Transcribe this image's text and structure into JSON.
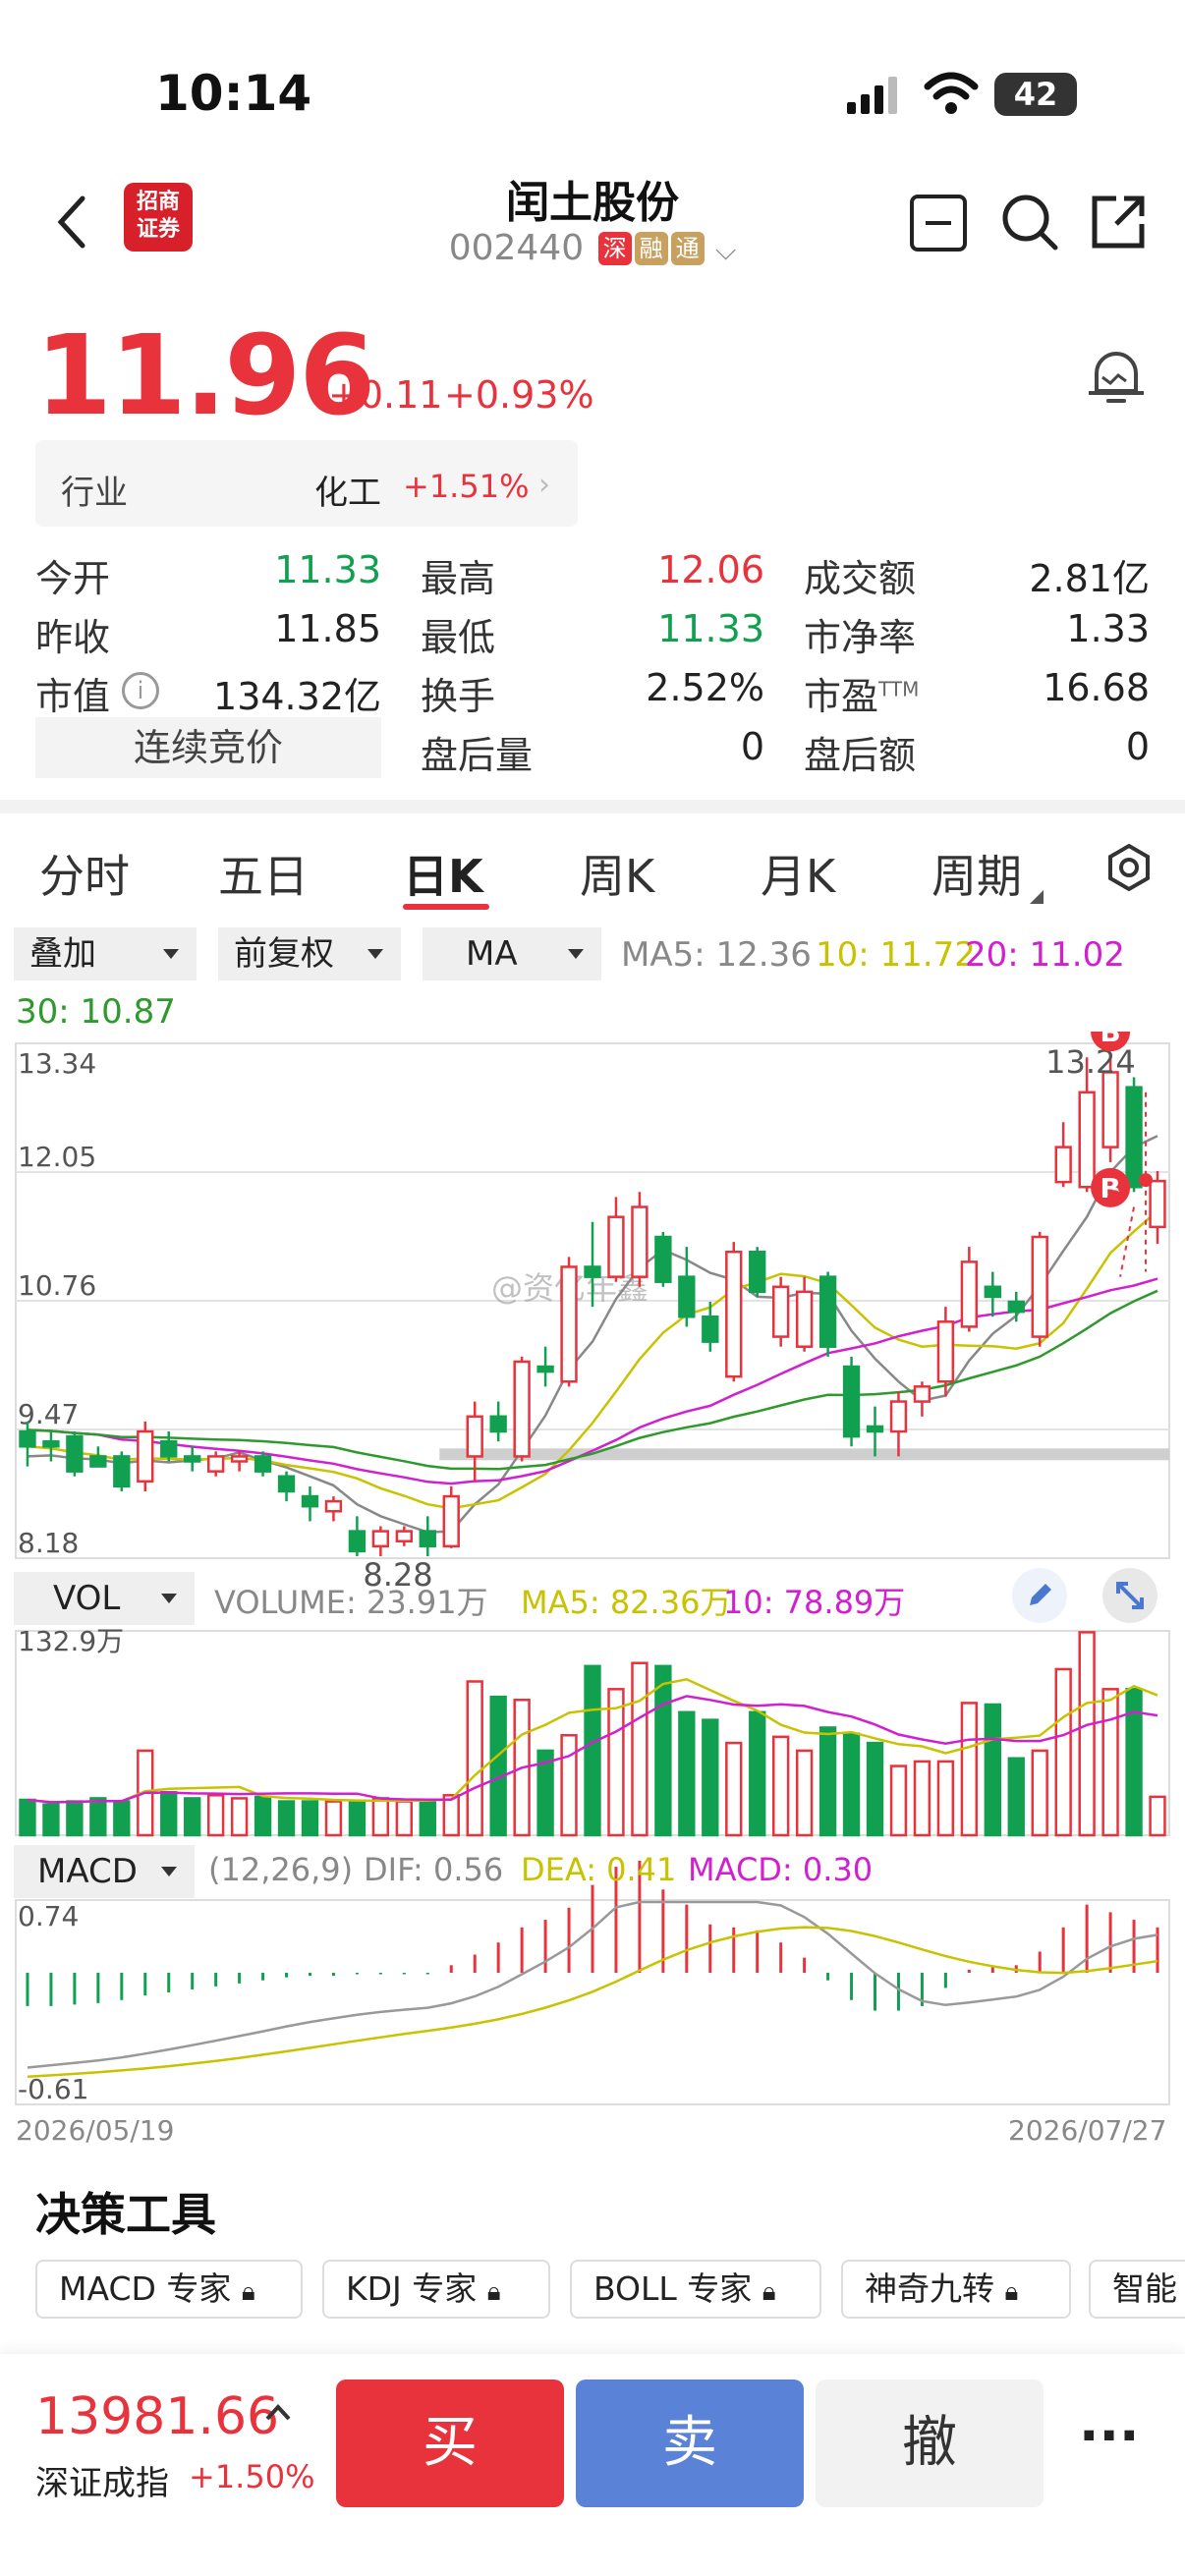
{
  "status": {
    "time": "10:14",
    "battery": "42"
  },
  "header": {
    "title": "闰土股份",
    "code": "002440",
    "tags": [
      "深",
      "融",
      "通"
    ],
    "logo_text": "招商证券"
  },
  "quote": {
    "price": "11.96",
    "change": "+0.11",
    "change_pct": "+0.93%"
  },
  "industry": {
    "label": "行业",
    "name": "化工",
    "pct": "+1.51%"
  },
  "stats": [
    {
      "label": "今开",
      "value": "11.33",
      "color": "green"
    },
    {
      "label": "最高",
      "value": "12.06",
      "color": "red"
    },
    {
      "label": "成交额",
      "value": "2.81亿",
      "color": "black"
    },
    {
      "label": "昨收",
      "value": "11.85",
      "color": "black"
    },
    {
      "label": "最低",
      "value": "11.33",
      "color": "green"
    },
    {
      "label": "市净率",
      "value": "1.33",
      "color": "black"
    },
    {
      "label": "市值",
      "value": "134.32亿",
      "color": "black"
    },
    {
      "label": "换手",
      "value": "2.52%",
      "color": "black"
    },
    {
      "label": "市盈",
      "value": "16.68",
      "color": "black",
      "sup": "TTM"
    },
    {
      "label": "盘后量",
      "value": "0",
      "color": "black"
    },
    {
      "label": "盘后额",
      "value": "0",
      "color": "black"
    }
  ],
  "continuous_bid": "连续竞价",
  "tabs": [
    "分时",
    "五日",
    "日K",
    "周K",
    "月K",
    "周期"
  ],
  "toolbar": {
    "overlay": "叠加",
    "adjust": "前复权",
    "indicator": "MA"
  },
  "ma_legend": {
    "ma5": "MA5: 12.36",
    "ma10": "10: 11.72",
    "ma20": "20: 11.02",
    "ma30": "30: 10.87"
  },
  "colors": {
    "up": "#e8323c",
    "down": "#11a050",
    "ma5": "#888888",
    "ma10": "#c9c200",
    "ma20": "#d020d0",
    "ma30": "#2e9a2e",
    "buy": "#e8323c",
    "sell": "#5a82d6"
  },
  "chart_data": [
    {
      "type": "candlestick",
      "y_axis_labels": [
        "13.34",
        "12.05",
        "10.76",
        "9.47",
        "8.18"
      ],
      "ylim": [
        8.18,
        13.34
      ],
      "high_label": "13.24",
      "low_label": "8.28",
      "candles": [
        {
          "o": 9.45,
          "h": 9.55,
          "l": 9.1,
          "c": 9.3
        },
        {
          "o": 9.35,
          "h": 9.45,
          "l": 9.15,
          "c": 9.3
        },
        {
          "o": 9.4,
          "h": 9.45,
          "l": 9.0,
          "c": 9.05
        },
        {
          "o": 9.2,
          "h": 9.3,
          "l": 9.1,
          "c": 9.1
        },
        {
          "o": 9.2,
          "h": 9.25,
          "l": 8.85,
          "c": 8.9
        },
        {
          "o": 8.95,
          "h": 9.55,
          "l": 8.85,
          "c": 9.45
        },
        {
          "o": 9.35,
          "h": 9.45,
          "l": 9.15,
          "c": 9.2
        },
        {
          "o": 9.2,
          "h": 9.3,
          "l": 9.05,
          "c": 9.15
        },
        {
          "o": 9.05,
          "h": 9.25,
          "l": 9.0,
          "c": 9.2
        },
        {
          "o": 9.15,
          "h": 9.25,
          "l": 9.05,
          "c": 9.2
        },
        {
          "o": 9.2,
          "h": 9.25,
          "l": 9.0,
          "c": 9.05
        },
        {
          "o": 9.0,
          "h": 9.05,
          "l": 8.75,
          "c": 8.85
        },
        {
          "o": 8.8,
          "h": 8.9,
          "l": 8.55,
          "c": 8.7
        },
        {
          "o": 8.65,
          "h": 8.8,
          "l": 8.55,
          "c": 8.75
        },
        {
          "o": 8.45,
          "h": 8.6,
          "l": 8.2,
          "c": 8.25
        },
        {
          "o": 8.3,
          "h": 8.5,
          "l": 8.2,
          "c": 8.45
        },
        {
          "o": 8.35,
          "h": 8.5,
          "l": 8.3,
          "c": 8.45
        },
        {
          "o": 8.45,
          "h": 8.6,
          "l": 8.2,
          "c": 8.3
        },
        {
          "o": 8.3,
          "h": 8.9,
          "l": 8.28,
          "c": 8.8
        },
        {
          "o": 9.2,
          "h": 9.75,
          "l": 8.95,
          "c": 9.6
        },
        {
          "o": 9.6,
          "h": 9.75,
          "l": 9.35,
          "c": 9.45
        },
        {
          "o": 9.2,
          "h": 10.2,
          "l": 9.15,
          "c": 10.15
        },
        {
          "o": 10.1,
          "h": 10.3,
          "l": 9.9,
          "c": 10.05
        },
        {
          "o": 9.95,
          "h": 11.2,
          "l": 9.9,
          "c": 11.1
        },
        {
          "o": 11.1,
          "h": 11.55,
          "l": 10.7,
          "c": 11.0
        },
        {
          "o": 11.0,
          "h": 11.8,
          "l": 10.95,
          "c": 11.6
        },
        {
          "o": 11.0,
          "h": 11.85,
          "l": 10.9,
          "c": 11.7
        },
        {
          "o": 11.4,
          "h": 11.45,
          "l": 10.9,
          "c": 10.95
        },
        {
          "o": 11.0,
          "h": 11.3,
          "l": 10.5,
          "c": 10.6
        },
        {
          "o": 10.6,
          "h": 10.75,
          "l": 10.25,
          "c": 10.35
        },
        {
          "o": 10.0,
          "h": 11.35,
          "l": 9.95,
          "c": 11.25
        },
        {
          "o": 11.25,
          "h": 11.3,
          "l": 10.8,
          "c": 10.85
        },
        {
          "o": 10.4,
          "h": 11.0,
          "l": 10.3,
          "c": 10.9
        },
        {
          "o": 10.3,
          "h": 11.0,
          "l": 10.25,
          "c": 10.85
        },
        {
          "o": 11.0,
          "h": 11.05,
          "l": 10.2,
          "c": 10.3
        },
        {
          "o": 10.1,
          "h": 10.2,
          "l": 9.3,
          "c": 9.4
        },
        {
          "o": 9.5,
          "h": 9.7,
          "l": 9.2,
          "c": 9.45
        },
        {
          "o": 9.45,
          "h": 9.85,
          "l": 9.2,
          "c": 9.75
        },
        {
          "o": 9.75,
          "h": 9.95,
          "l": 9.6,
          "c": 9.9
        },
        {
          "o": 9.95,
          "h": 10.7,
          "l": 9.8,
          "c": 10.55
        },
        {
          "o": 10.5,
          "h": 11.3,
          "l": 10.45,
          "c": 11.15
        },
        {
          "o": 10.9,
          "h": 11.05,
          "l": 10.6,
          "c": 10.8
        },
        {
          "o": 10.75,
          "h": 10.85,
          "l": 10.55,
          "c": 10.65
        },
        {
          "o": 10.4,
          "h": 11.45,
          "l": 10.3,
          "c": 11.4
        },
        {
          "o": 11.95,
          "h": 12.55,
          "l": 11.9,
          "c": 12.3
        },
        {
          "o": 11.9,
          "h": 13.2,
          "l": 11.85,
          "c": 12.85
        },
        {
          "o": 12.3,
          "h": 13.24,
          "l": 12.15,
          "c": 13.05
        },
        {
          "o": 12.9,
          "h": 13.0,
          "l": 11.85,
          "c": 11.9
        },
        {
          "o": 11.5,
          "h": 12.06,
          "l": 11.33,
          "c": 11.96
        }
      ],
      "markers": [
        {
          "label": "B",
          "candle": 46,
          "position": "top"
        },
        {
          "label": "B",
          "candle": 46,
          "position": "bottom"
        }
      ]
    },
    {
      "type": "bar",
      "title": "VOL",
      "legend": {
        "volume": "VOLUME: 23.91万",
        "ma5": "MA5: 82.36万",
        "ma10": "10: 78.89万"
      },
      "y_axis_label": "132.9万",
      "ylim": [
        0,
        132.9
      ],
      "values": [
        23,
        20,
        22,
        24,
        22,
        55,
        28,
        24,
        26,
        24,
        25,
        22,
        22,
        22,
        22,
        24,
        22,
        23,
        26,
        100,
        90,
        88,
        55,
        65,
        110,
        95,
        112,
        110,
        80,
        75,
        60,
        80,
        64,
        55,
        70,
        66,
        60,
        45,
        48,
        48,
        86,
        85,
        50,
        55,
        108,
        132,
        95,
        95,
        25
      ]
    },
    {
      "type": "bar",
      "title": "MACD",
      "legend": {
        "params": "(12,26,9)",
        "dif": "DIF: 0.56",
        "dea": "DEA: 0.41",
        "macd": "MACD: 0.30"
      },
      "y_axis_labels": [
        "0.74",
        "-0.61"
      ],
      "ylim": [
        -0.61,
        0.74
      ],
      "values": [
        -0.22,
        -0.22,
        -0.21,
        -0.2,
        -0.18,
        -0.15,
        -0.13,
        -0.11,
        -0.09,
        -0.07,
        -0.05,
        -0.03,
        -0.02,
        -0.02,
        -0.01,
        -0.01,
        -0.01,
        -0.01,
        0.05,
        0.12,
        0.2,
        0.3,
        0.35,
        0.43,
        0.58,
        0.7,
        0.74,
        0.55,
        0.45,
        0.32,
        0.3,
        0.28,
        0.2,
        0.1,
        -0.05,
        -0.18,
        -0.25,
        -0.25,
        -0.22,
        -0.1,
        0.02,
        0.04,
        0.05,
        0.14,
        0.3,
        0.45,
        0.4,
        0.35,
        0.3
      ]
    }
  ],
  "x_axis": {
    "start": "2026/05/19",
    "end": "2026/07/27"
  },
  "watermark": "@资亿年鑫",
  "tools": {
    "title": "决策工具",
    "items": [
      "MACD 专家",
      "KDJ 专家",
      "BOLL 专家",
      "神奇九转",
      "智能"
    ]
  },
  "index": {
    "value": "13981.66",
    "name": "深证成指",
    "pct": "+1.50%"
  },
  "actions": {
    "buy": "买",
    "sell": "卖",
    "cancel": "撤",
    "more": "···"
  }
}
